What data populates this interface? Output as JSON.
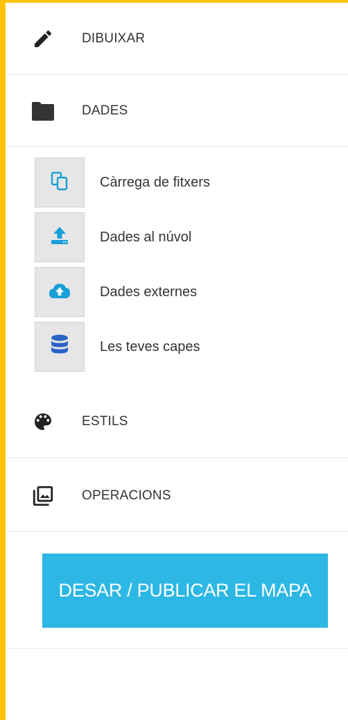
{
  "colors": {
    "frame": "#ffc20e",
    "accent": "#2db7e5",
    "sub_icon_blue": "#1a9fd9",
    "database_blue": "#2a63c6",
    "text": "#333333"
  },
  "menu": {
    "draw": {
      "label": "DIBUIXAR",
      "icon": "pencil-icon"
    },
    "data": {
      "label": "DADES",
      "icon": "folder-icon"
    },
    "styles": {
      "label": "ESTILS",
      "icon": "palette-icon"
    },
    "operations": {
      "label": "OPERACIONS",
      "icon": "photo-library-icon"
    }
  },
  "data_submenu": [
    {
      "label": "Càrrega de fitxers",
      "icon": "copy-files-icon"
    },
    {
      "label": "Dades al núvol",
      "icon": "upload-icon"
    },
    {
      "label": "Dades externes",
      "icon": "cloud-upload-icon"
    },
    {
      "label": "Les teves capes",
      "icon": "database-icon"
    }
  ],
  "publish": {
    "label": "DESAR / PUBLICAR EL MAPA"
  }
}
